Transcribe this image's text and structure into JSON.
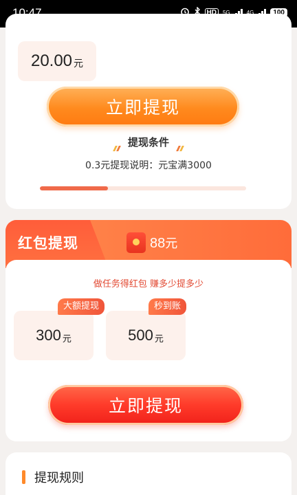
{
  "status_bar": {
    "time": "10:47",
    "hd": "HD",
    "net_5g": "5G",
    "net_4g": "4G",
    "battery": "100"
  },
  "top_card": {
    "amount_value": "20.00",
    "amount_unit": "元",
    "withdraw_button": "立即提现",
    "condition_title": "提现条件",
    "condition_desc": "0.3元提现说明：元宝满3000",
    "progress_fraction": 0.33
  },
  "red_packet": {
    "title": "红包提现",
    "balance_value": "88",
    "balance_unit": "元",
    "tagline": "做任务得红包 赚多少提多少",
    "options": [
      {
        "value": "300",
        "unit": "元",
        "badge": "大额提现"
      },
      {
        "value": "500",
        "unit": "元",
        "badge": "秒到账"
      }
    ],
    "withdraw_button": "立即提现"
  },
  "rules": {
    "title": "提现规则"
  },
  "colors": {
    "accent_orange": "#ff8a1e",
    "accent_red": "#f0201a",
    "tile_bg": "#fdf1ec"
  }
}
